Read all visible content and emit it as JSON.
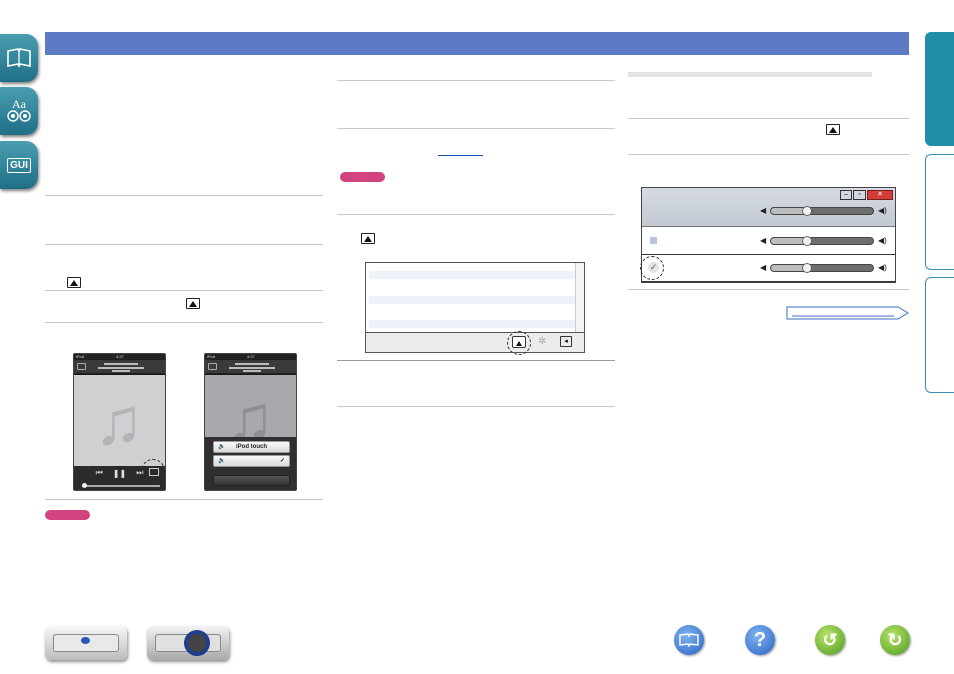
{
  "left_tabs": [
    {
      "name": "contents-book-icon",
      "label": ""
    },
    {
      "name": "glossary-icon",
      "label": "Aa"
    },
    {
      "name": "gui-icon",
      "label": "GUI"
    }
  ],
  "right_tabs": [
    {
      "name": "right-tab-1",
      "color": "#1e8fa6"
    },
    {
      "name": "right-tab-2",
      "color": "#ffffff"
    },
    {
      "name": "right-tab-3",
      "color": "#ffffff"
    }
  ],
  "header_bar": {
    "color": "#5b7cc4"
  },
  "phones": {
    "left": {
      "status": "iPod",
      "time": "4:27"
    },
    "right": {
      "status": "iPod",
      "time": "4:27",
      "menu_item_1": "iPod touch",
      "menu_item_2": ""
    }
  },
  "colors": {
    "accent": "#5b7cc4",
    "note": "#d2447f",
    "teal": "#1e8fa6"
  },
  "bottom_nav": {
    "device_buttons": [
      "front-panel-button",
      "rear-panel-button"
    ],
    "icons": [
      "manual-book-icon",
      "help-icon",
      "back-icon",
      "forward-icon"
    ]
  }
}
